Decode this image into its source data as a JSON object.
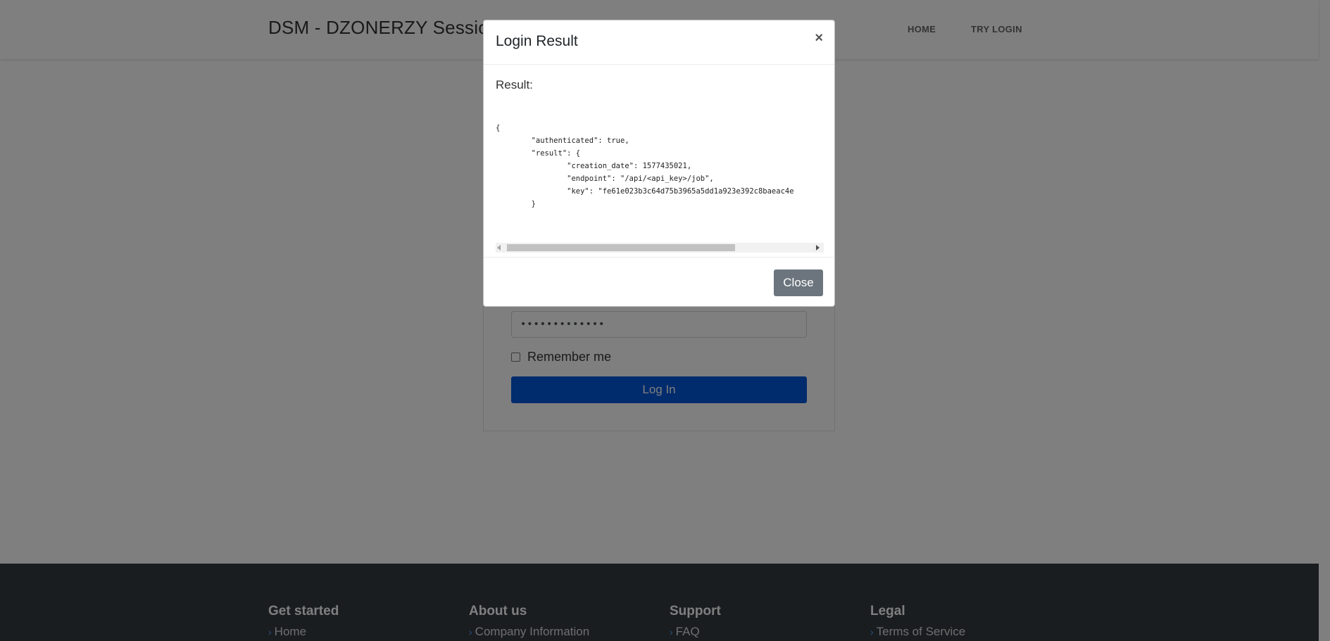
{
  "navbar": {
    "brand": "DSM - DZONERZY Session",
    "links": [
      "HOME",
      "TRY LOGIN"
    ]
  },
  "login_form": {
    "password_value": "•••••••••••••",
    "remember_label": "Remember me",
    "login_button": "Log In"
  },
  "footer": {
    "columns": [
      {
        "heading": "Get started",
        "link": "Home"
      },
      {
        "heading": "About us",
        "link": "Company Information"
      },
      {
        "heading": "Support",
        "link": "FAQ"
      },
      {
        "heading": "Legal",
        "link": "Terms of Service"
      }
    ]
  },
  "modal": {
    "title": "Login Result",
    "close_symbol": "×",
    "result_label": "Result:",
    "result_code": "{\n        \"authenticated\": true,\n        \"result\": {\n                \"creation_date\": 1577435021,\n                \"endpoint\": \"/api/<api_key>/job\",\n                \"key\": \"fe61e023b3c64d75b3965a5dd1a923e392c8baeac4e\n        }\n}",
    "close_button": "Close"
  },
  "colors": {
    "primary_button": "#0057d8",
    "secondary_button": "#6c757d",
    "footer_bg": "#343a40",
    "backdrop": "rgba(0,0,0,0.5)"
  }
}
